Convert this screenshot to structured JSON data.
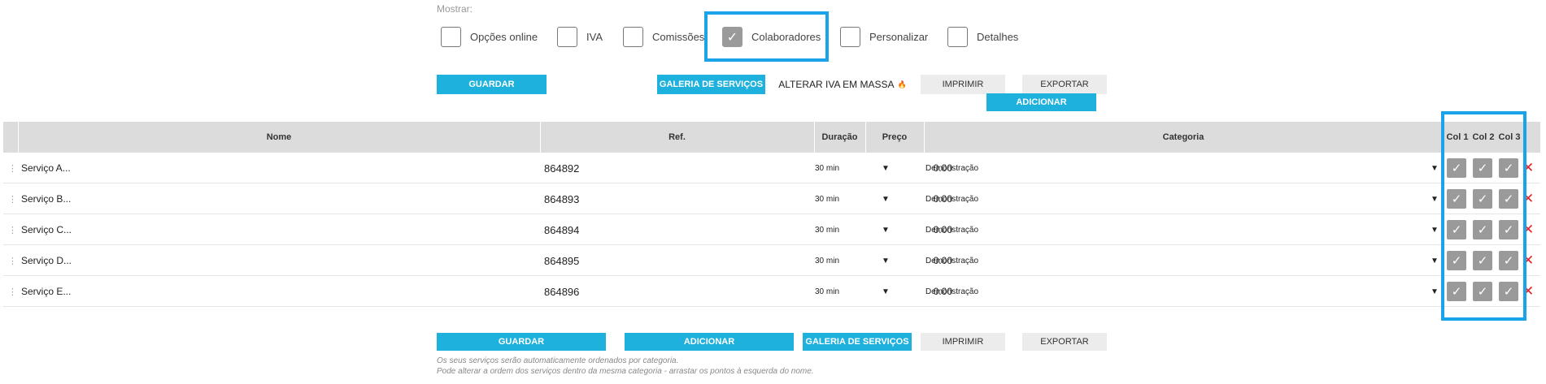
{
  "filters": {
    "title": "Mostrar:",
    "options": [
      {
        "label": "Opções online",
        "checked": false
      },
      {
        "label": "IVA",
        "checked": false
      },
      {
        "label": "Comissões",
        "checked": false
      },
      {
        "label": "Colaboradores",
        "checked": true
      },
      {
        "label": "Personalizar",
        "checked": false
      },
      {
        "label": "Detalhes",
        "checked": false
      }
    ]
  },
  "toolbar_top": {
    "save": "GUARDAR",
    "gallery": "GALERIA DE SERVIÇOS",
    "vat_bulk": "ALTERAR IVA EM MASSA",
    "print": "IMPRIMIR",
    "export": "EXPORTAR",
    "add": "ADICIONAR"
  },
  "table": {
    "headers": {
      "name": "Nome",
      "ref": "Ref.",
      "duration": "Duração",
      "price": "Preço",
      "category": "Categoria",
      "col1": "Col 1",
      "col2": "Col 2",
      "col3": "Col 3"
    },
    "rows": [
      {
        "name": "Serviço A...",
        "ref": "864892",
        "duration": "30 min",
        "price": "0.00",
        "category": "Demonstração"
      },
      {
        "name": "Serviço B...",
        "ref": "864893",
        "duration": "30 min",
        "price": "0.00",
        "category": "Demonstração"
      },
      {
        "name": "Serviço C...",
        "ref": "864894",
        "duration": "30 min",
        "price": "0.00",
        "category": "Demonstração"
      },
      {
        "name": "Serviço D...",
        "ref": "864895",
        "duration": "30 min",
        "price": "0.00",
        "category": "Demonstração"
      },
      {
        "name": "Serviço E...",
        "ref": "864896",
        "duration": "30 min",
        "price": "0.00",
        "category": "Demonstração"
      }
    ]
  },
  "toolbar_bottom": {
    "save": "GUARDAR",
    "add": "ADICIONAR",
    "gallery": "GALERIA DE SERVIÇOS",
    "print": "IMPRIMIR",
    "export": "EXPORTAR"
  },
  "notes": {
    "line1": "Os seus serviços serão automaticamente ordenados por categoria.",
    "line2": "Pode alterar a ordem dos serviços dentro da mesma categoria - arrastar os pontos à esquerda do nome."
  },
  "glyphs": {
    "check": "✓",
    "dropdown": "▼",
    "delete": "✕",
    "handle": "⋮",
    "flame": "🔥"
  },
  "colors": {
    "accent": "#1eb1dd",
    "highlight": "#1aa3e8",
    "delete": "#e81d1d",
    "checkbox_checked": "#9a9a9a"
  }
}
